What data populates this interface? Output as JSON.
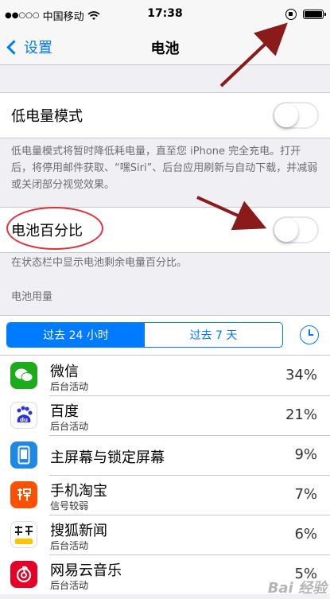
{
  "status_bar": {
    "carrier_dots": "●●○○○",
    "carrier": "中国移动",
    "wifi": "wifi-icon",
    "time": "17:38",
    "rotation_lock": "rotation-lock-icon",
    "battery": "battery-icon"
  },
  "nav": {
    "back_label": "设置",
    "title": "电池"
  },
  "low_power": {
    "label": "低电量模式",
    "enabled": false,
    "note": "低电量模式将暂时降低耗电量，直至您 iPhone 完全充电。打开后，将停用邮件获取、“嘿Siri”、后台应用刷新与自动下载，并减弱或关闭部分视觉效果。"
  },
  "battery_percentage": {
    "label": "电池百分比",
    "enabled": false,
    "note": "在状态栏中显示电池剩余电量百分比。"
  },
  "usage": {
    "header": "电池用量",
    "tabs": [
      "过去 24 小时",
      "过去 7 天"
    ],
    "selected_tab": 0,
    "clock_icon": "clock-icon",
    "apps": [
      {
        "name": "微信",
        "sub": "后台活动",
        "pct": "34%",
        "icon": "wechat-icon",
        "color": "#1aad19",
        "glyph": "◍"
      },
      {
        "name": "百度",
        "sub": "后台活动",
        "pct": "21%",
        "icon": "baidu-icon",
        "color": "#ffffff",
        "glyph": "du"
      },
      {
        "name": "主屏幕与锁定屏幕",
        "sub": "",
        "pct": "9%",
        "icon": "homescreen-icon",
        "color": "#1d88e5",
        "glyph": "▯"
      },
      {
        "name": "手机淘宝",
        "sub": "信号较弱",
        "pct": "7%",
        "icon": "taobao-icon",
        "color": "#ff5000",
        "glyph": "淘"
      },
      {
        "name": "搜狐新闻",
        "sub": "后台活动",
        "pct": "6%",
        "icon": "sohu-news-icon",
        "color": "#ffffff",
        "glyph": "搜狐"
      },
      {
        "name": "网易云音乐",
        "sub": "后台活动",
        "pct": "5%",
        "icon": "netease-music-icon",
        "color": "#e60026",
        "glyph": "◎"
      }
    ]
  },
  "watermark": "Bai 经验"
}
